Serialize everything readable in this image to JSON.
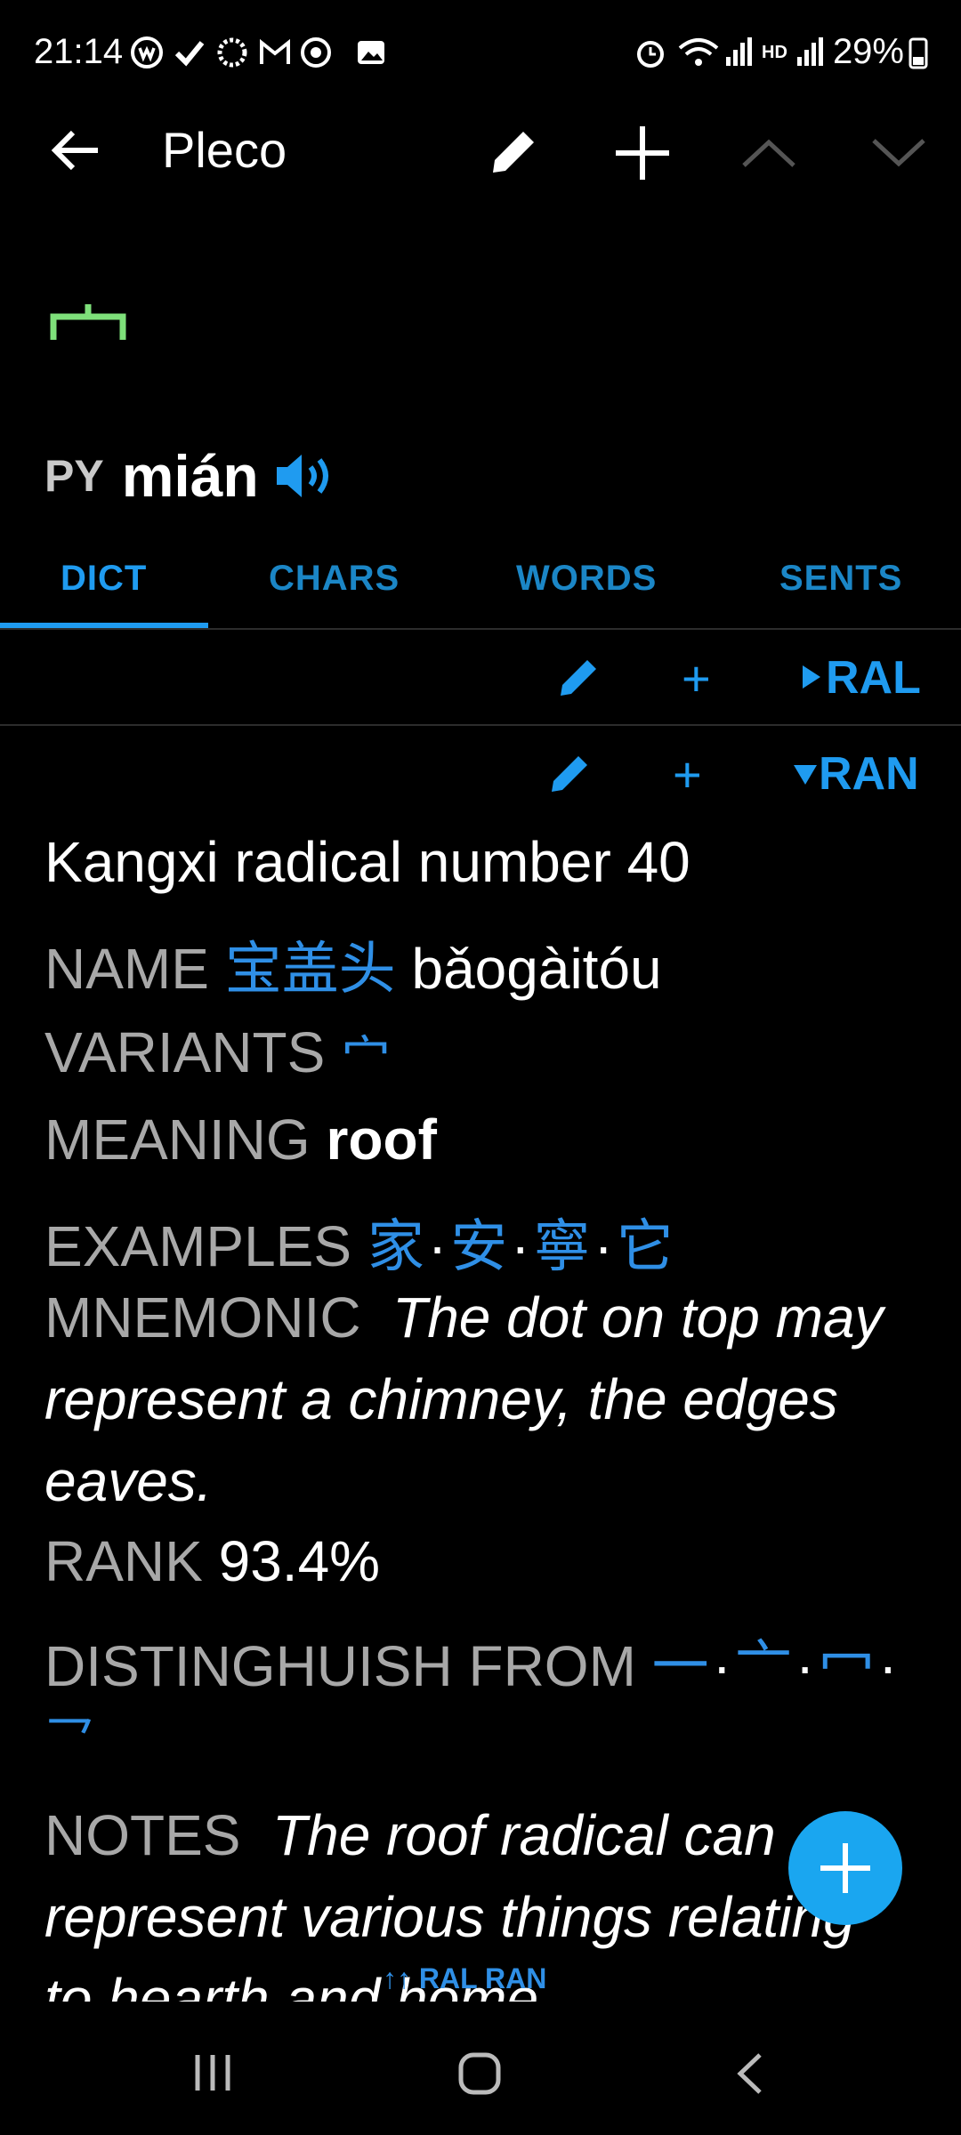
{
  "status_bar": {
    "time": "21:14",
    "battery": "29%",
    "left_icons": [
      "app-icon",
      "check-icon",
      "cloud-icon",
      "gmail-icon",
      "chrome-icon",
      "gallery-icon"
    ],
    "right_icons": [
      "alarm-icon",
      "wifi-icon",
      "signal-icon",
      "hd-icon",
      "signal-icon",
      "battery-icon"
    ]
  },
  "app_bar": {
    "title": "Pleco"
  },
  "headword": {
    "radical": "宀",
    "py_tag": "PY",
    "pinyin": "mián"
  },
  "tabs": [
    {
      "label": "DICT",
      "active": true
    },
    {
      "label": "CHARS",
      "active": false
    },
    {
      "label": "WORDS",
      "active": false
    },
    {
      "label": "SENTS",
      "active": false
    }
  ],
  "toolbar_ral": {
    "label": "RAL"
  },
  "toolbar_ran": {
    "label": "RAN"
  },
  "entry": {
    "definition": "Kangxi radical number 40",
    "name_label": "NAME",
    "name_chars": "宝盖头",
    "name_pinyin": "bǎogàitóu",
    "variants_label": "VARIANTS",
    "variants": "宀",
    "meaning_label": "MEANING",
    "meaning": "roof",
    "examples_label": "EXAMPLES",
    "examples": [
      "家",
      "安",
      "寧",
      "它"
    ],
    "mnemonic_label": "MNEMONIC",
    "mnemonic_line1": "The dot on top may",
    "mnemonic_line2": "represent a chimney, the edges",
    "mnemonic_line3": "eaves.",
    "rank_label": "RANK",
    "rank": "93.4%",
    "distinguish_label": "DISTINGHUISH FROM",
    "distinguish": [
      "一",
      "亠",
      "冖",
      "乛"
    ],
    "notes_label": "NOTES",
    "notes_line1": "The roof radical can",
    "notes_line2": "represent various things relating",
    "notes_line3": "to hearth and home"
  },
  "mini_tabs": {
    "arrows": "↑↑",
    "ral": "RAL",
    "ran": "RAN"
  },
  "colors": {
    "accent": "#1f9bf0",
    "fab": "#1aa6f0",
    "label_gray": "#a8a8a8",
    "green": "#7ee07a"
  }
}
